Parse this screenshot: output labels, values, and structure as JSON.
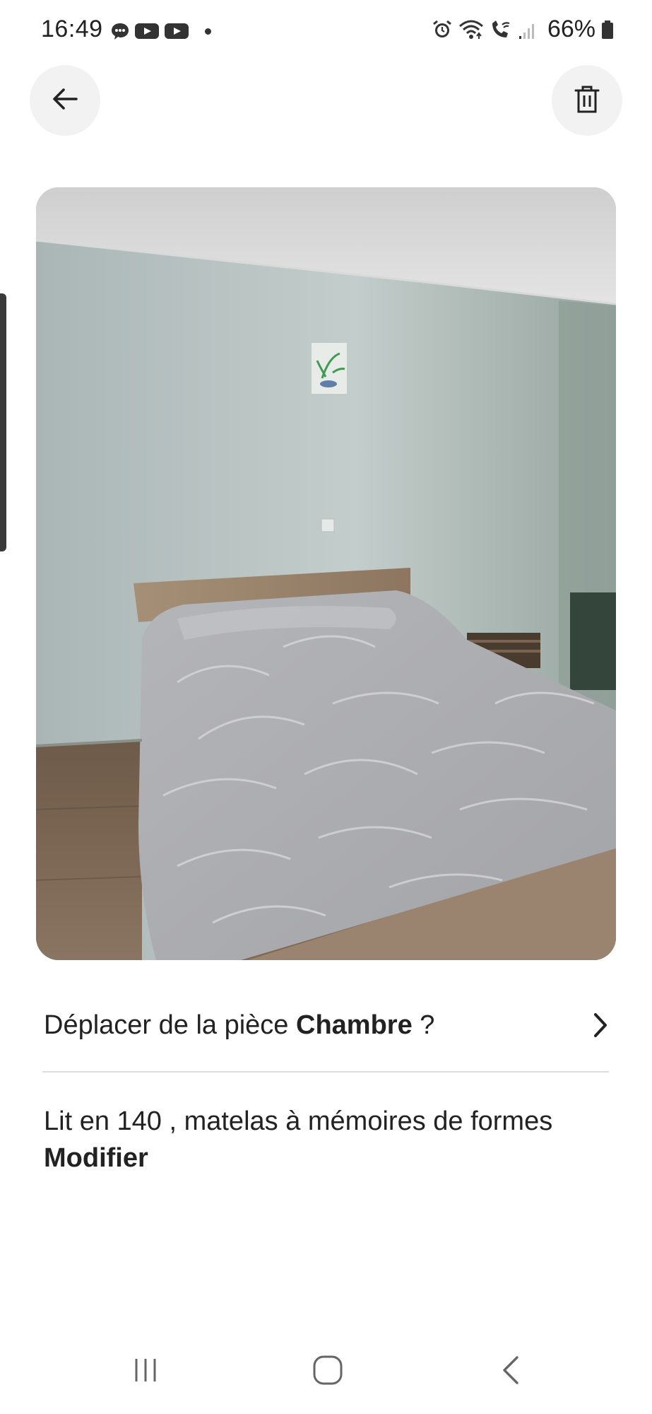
{
  "status_bar": {
    "time": "16:49",
    "battery": "66%",
    "left_icons": [
      "chat-bubble-icon",
      "youtube-icon",
      "youtube-icon",
      "notification-dot-icon"
    ],
    "right_icons": [
      "alarm-icon",
      "wifi-icon",
      "wifi-calling-icon",
      "signal-icon",
      "battery-icon"
    ]
  },
  "toolbar": {
    "back_icon": "arrow-left-icon",
    "delete_icon": "trash-icon"
  },
  "photo": {
    "subject_icon": "bedroom-photo"
  },
  "move_row": {
    "prefix": "Déplacer de la pièce ",
    "room": "Chambre",
    "suffix": " ?",
    "chevron_icon": "chevron-right-icon"
  },
  "caption": {
    "text": "Lit en 140 , matelas à mémoires de formes",
    "edit_label": "Modifier"
  },
  "nav": {
    "recent_icon": "recent-apps-icon",
    "home_icon": "home-icon",
    "back_icon": "back-icon"
  },
  "colors": {
    "button_bg": "#f2f2f2",
    "divider": "#dedede",
    "text": "#222222"
  }
}
